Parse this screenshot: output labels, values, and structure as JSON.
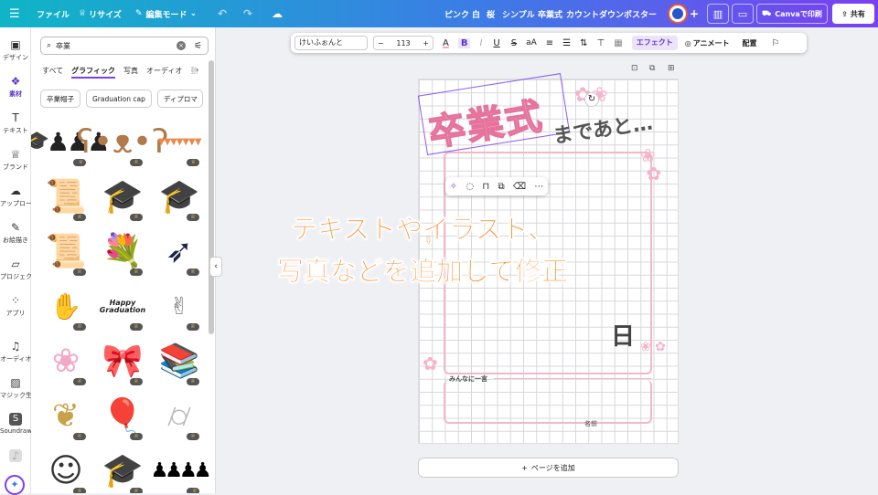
{
  "topbar": {
    "file": "ファイル",
    "resize": "リサイズ",
    "edit_mode": "編集モード",
    "tags": [
      "ピンク",
      "白",
      "桜",
      "シンプル",
      "卒業式",
      "カウントダウン",
      "ポスター"
    ],
    "print": "Canvaで印刷",
    "share": "共有",
    "colors": {
      "grad_start": "#0fb5c7",
      "grad_end": "#7b3ff2"
    }
  },
  "rail": {
    "items": [
      {
        "label": "デザイン",
        "icon": "layout-icon"
      },
      {
        "label": "素材",
        "icon": "elements-icon"
      },
      {
        "label": "テキスト",
        "icon": "text-icon"
      },
      {
        "label": "ブランド",
        "icon": "brand-icon"
      },
      {
        "label": "アップロード",
        "icon": "upload-icon"
      },
      {
        "label": "お絵描き",
        "icon": "draw-icon"
      },
      {
        "label": "プロジェクト",
        "icon": "folder-icon"
      },
      {
        "label": "アプリ",
        "icon": "apps-icon"
      },
      {
        "label": "オーディオ",
        "icon": "music-icon"
      },
      {
        "label": "マジック生成",
        "icon": "magic-icon"
      },
      {
        "label": "Soundraw",
        "icon": "soundraw-icon"
      }
    ]
  },
  "panel": {
    "search_value": "卒業",
    "tabs": [
      "すべて",
      "グラフィック",
      "写真",
      "オーディオ",
      "動"
    ],
    "chips": [
      "卒業帽子",
      "Graduation cap",
      "ディプロマ"
    ],
    "thumbs": [
      "silhouettes",
      "teddy-bear",
      "bunting",
      "diploma-scroll",
      "grad-cap",
      "cap-diploma",
      "certificate",
      "bouquet",
      "rolled-diploma",
      "line-art-hand",
      "happy-graduation",
      "line-art-caps",
      "flower-wreath",
      "ribbon-scroll",
      "books-flowers",
      "laurel-cap",
      "balloons",
      "tube-scroll",
      "line-art-girl",
      "black-cap",
      "jumping-crowd"
    ],
    "happy_graduation_text": "Happy Graduation"
  },
  "toolbar": {
    "font": "けいふぉんと",
    "minus": "−",
    "size": "113",
    "plus": "+",
    "effect": "エフェクト",
    "animate": "アニメート",
    "position": "配置"
  },
  "canvas": {
    "title": "卒業式",
    "subtitle": "まであと…",
    "day_char": "日",
    "message_label": "みんなに一言",
    "name_label": "名前"
  },
  "overlay": {
    "line1": "テキストやイラスト、",
    "line2": "写真などを追加して修正"
  },
  "add_page": "ページを追加"
}
